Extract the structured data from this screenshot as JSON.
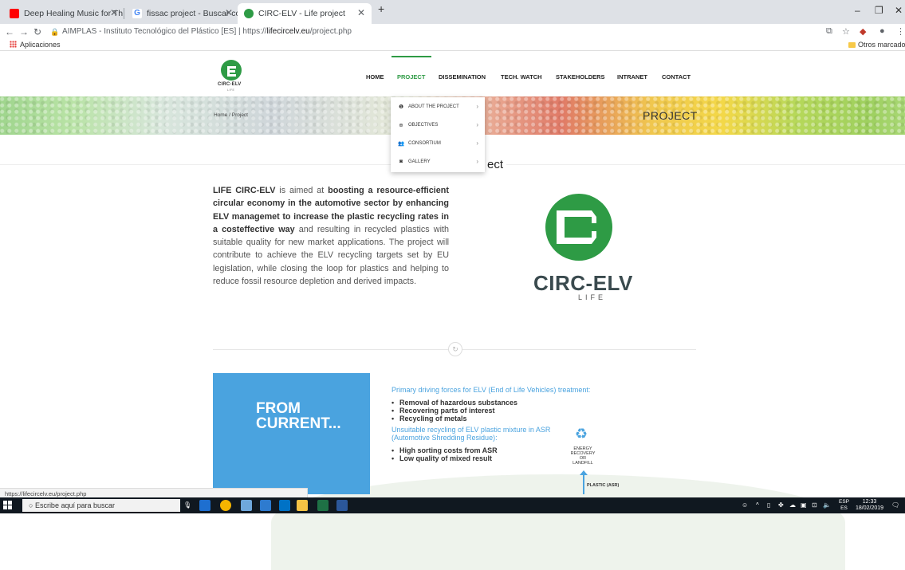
{
  "browser": {
    "tabs": [
      {
        "title": "Deep Healing Music for The ",
        "icon": "youtube-icon",
        "color": "#ff0000"
      },
      {
        "title": "fissac project - Buscar con Googl",
        "icon": "google-icon",
        "color": "#4285f4"
      },
      {
        "title": "CIRC-ELV - Life project",
        "icon": "circelv-icon",
        "color": "#2e9b45"
      }
    ],
    "new_tab": "+",
    "site_name": "AIMPLAS - Instituto Tecnológico del Plástico [ES]",
    "url_prefix": "https://",
    "url_domain": "lifecircelv.eu",
    "url_path": "/project.php",
    "bookmarks_apps": "Aplicaciones",
    "bookmarks_other": "Otros marcadores"
  },
  "site": {
    "logo_text": "CIRC-ELV",
    "logo_life": "LIFE",
    "nav": [
      "HOME",
      "PROJECT",
      "DISSEMINATION",
      "TECH. WATCH",
      "STAKEHOLDERS",
      "INTRANET",
      "CONTACT"
    ],
    "nav_active": "PROJECT",
    "accent": "#2e9b45",
    "breadcrumb": "Home  /  Project",
    "banner_title": "PROJECT",
    "section_title_visible": "ect",
    "dropdown": [
      {
        "label": "ABOUT THE PROJECT",
        "icon": "info-icon"
      },
      {
        "label": "OBJECTIVES",
        "icon": "target-icon"
      },
      {
        "label": "CONSORTIUM",
        "icon": "group-icon"
      },
      {
        "label": "GALLERY",
        "icon": "camera-icon"
      }
    ],
    "intro": {
      "p1": "LIFE CIRC-ELV",
      "p2": " is aimed at ",
      "p3": "boosting a resource-efficient circular economy in the automotive sector by enhancing ELV managemet to increase the plastic recycling rates in a costeffective way",
      "p4": " and resulting in recycled plastics with suitable quality for new market applications. The project will contribute to achieve the ELV recycling targets set by EU legislation, while closing the loop for plastics and helping to reduce fossil resource depletion and derived impacts."
    },
    "big_logo_text": "CIRC-ELV",
    "big_logo_life": "LIFE",
    "blue_box": "FROM CURRENT...",
    "panel": {
      "head1": "Primary driving forces for ELV (End of Life Vehicles) treatment:",
      "list1": [
        "Removal of hazardous substances",
        "Recovering parts of interest",
        "Recycling of metals"
      ],
      "head2": "Unsuitable recycling of ELV plastic mixture in ASR (Automotive Shredding Residue):",
      "list2": [
        "High sorting costs from ASR",
        "Low quality of mixed result"
      ],
      "energy": "ENERGY RECOVERY OR LANDFILL",
      "plastic": "PLASTIC (ASR)"
    },
    "status_url": "https://lifecircelv.eu/project.php"
  },
  "taskbar": {
    "search_placeholder": "Escribe aquí para buscar",
    "lang_top": "ESP",
    "lang_bottom": "ES",
    "time": "12:33",
    "date": "18/02/2019"
  }
}
